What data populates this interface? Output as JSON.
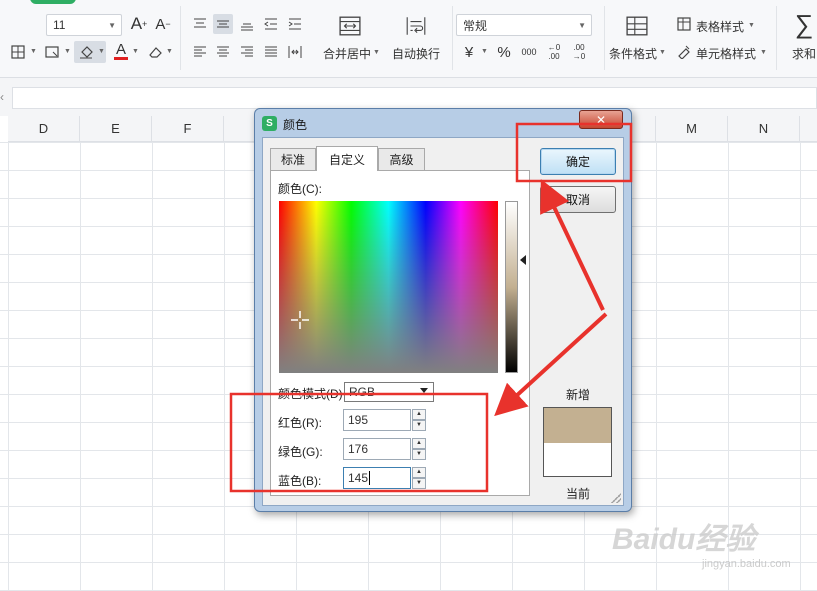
{
  "ribbon": {
    "font_size": "11",
    "number_format": "常规",
    "merge_center_label": "合并居中",
    "wrap_text_label": "自动换行",
    "conditional_format_label": "条件格式",
    "table_style_label": "表格样式",
    "cell_style_label": "单元格样式",
    "sum_label": "求和",
    "currency_symbol": "¥",
    "percent_symbol": "%",
    "thousands_symbol": "000",
    "increase_decimal_symbol": "←0 .00",
    "decrease_decimal_symbol": ".00 →0",
    "font_color_letter": "A",
    "grow_font_letter": "A",
    "shrink_font_letter": "A",
    "accent_color": "#2fae64",
    "font_color_bar": "#e02020"
  },
  "grid": {
    "column_headers": [
      "D",
      "E",
      "F",
      "M",
      "N"
    ]
  },
  "dialog": {
    "title": "颜色",
    "close_glyph": "✕",
    "tabs": [
      {
        "label": "标准",
        "active": false
      },
      {
        "label": "自定义",
        "active": true
      },
      {
        "label": "高级",
        "active": false
      }
    ],
    "colors_label": "颜色(C):",
    "color_mode_label": "颜色模式(D)",
    "color_mode_value": "RGB",
    "red_label": "红色(R):",
    "red_value": "195",
    "green_label": "绿色(G):",
    "green_value": "176",
    "blue_label": "蓝色(B):",
    "blue_value": "145",
    "ok_label": "确定",
    "cancel_label": "取消",
    "new_label": "新增",
    "current_label": "当前",
    "new_color": "#c3b091",
    "current_color": "#ffffff"
  },
  "annotations": {
    "highlight_color": "#e8322c"
  },
  "watermark": {
    "text": "Baidu经验",
    "subtext": "jingyan.baidu.com"
  }
}
